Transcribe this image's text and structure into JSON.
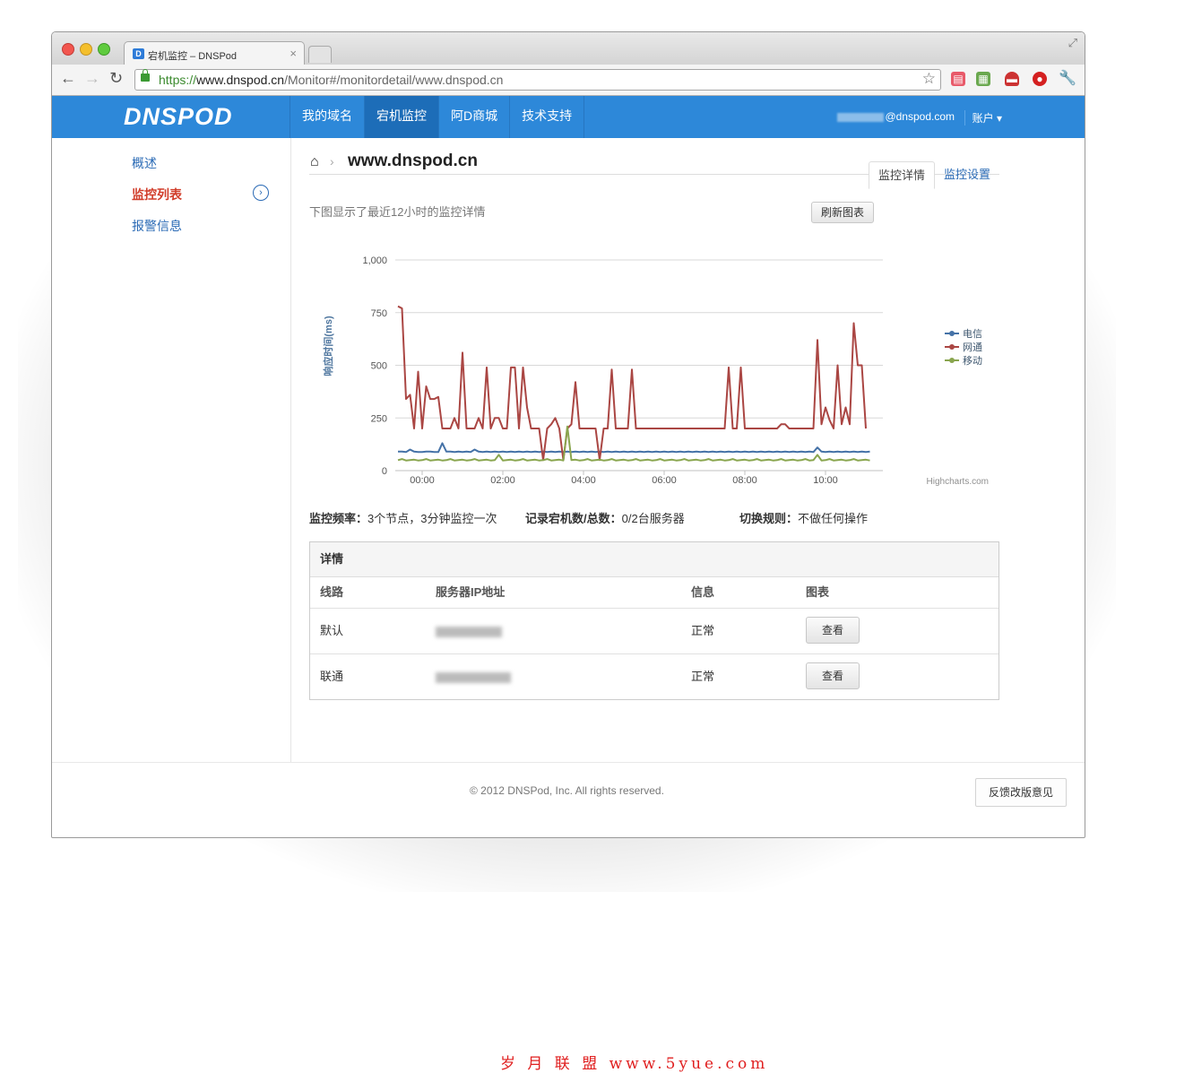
{
  "browser": {
    "tab_title": "宕机监控 – DNSPod",
    "tab_close": "×",
    "url_scheme": "https://",
    "url_host": "www.dnspod.cn",
    "url_path": "/Monitor#/monitordetail/www.dnspod.cn"
  },
  "site": {
    "logo": "DNSPOD",
    "nav": [
      "我的域名",
      "宕机监控",
      "阿D商城",
      "技术支持"
    ],
    "user_email": "@dnspod.com",
    "account_label": "账户 ▾"
  },
  "sidebar": {
    "items": [
      {
        "label": "概述"
      },
      {
        "label": "监控列表"
      },
      {
        "label": "报警信息"
      }
    ]
  },
  "breadcrumb": {
    "domain": "www.dnspod.cn"
  },
  "tabs": {
    "detail": "监控详情",
    "settings": "监控设置"
  },
  "chart_area": {
    "description": "下图显示了最近12小时的监控详情",
    "refresh_button": "刷新图表",
    "credit": "Highcharts.com"
  },
  "chart_data": {
    "type": "line",
    "title": "",
    "ylabel": "响应时间(ms)",
    "xlabel": "",
    "ylim": [
      0,
      1000
    ],
    "yticks": [
      "0",
      "250",
      "500",
      "750",
      "1,000"
    ],
    "xticks": [
      "00:00",
      "02:00",
      "04:00",
      "06:00",
      "08:00",
      "10:00"
    ],
    "x_hours": [
      -0.6,
      -0.5,
      -0.4,
      -0.3,
      -0.2,
      -0.1,
      0.0,
      0.1,
      0.2,
      0.3,
      0.4,
      0.5,
      0.6,
      0.7,
      0.8,
      0.9,
      1.0,
      1.1,
      1.2,
      1.3,
      1.4,
      1.5,
      1.6,
      1.7,
      1.8,
      1.9,
      2.0,
      2.1,
      2.2,
      2.3,
      2.4,
      2.5,
      2.6,
      2.7,
      2.8,
      2.9,
      3.0,
      3.1,
      3.2,
      3.3,
      3.4,
      3.5,
      3.6,
      3.7,
      3.8,
      3.9,
      4.0,
      4.1,
      4.2,
      4.3,
      4.4,
      4.5,
      4.6,
      4.7,
      4.8,
      4.9,
      5.0,
      5.1,
      5.2,
      5.3,
      5.4,
      5.5,
      5.6,
      5.7,
      5.8,
      5.9,
      6.0,
      6.1,
      6.2,
      6.3,
      6.4,
      6.5,
      6.6,
      6.7,
      6.8,
      6.9,
      7.0,
      7.1,
      7.2,
      7.3,
      7.4,
      7.5,
      7.6,
      7.7,
      7.8,
      7.9,
      8.0,
      8.1,
      8.2,
      8.3,
      8.4,
      8.5,
      8.6,
      8.7,
      8.8,
      8.9,
      9.0,
      9.1,
      9.2,
      9.3,
      9.4,
      9.5,
      9.6,
      9.7,
      9.8,
      9.9,
      10.0,
      10.1,
      10.2,
      10.3,
      10.4,
      10.5,
      10.6,
      10.7,
      10.8,
      10.9,
      11.0,
      11.1,
      11.2
    ],
    "series": [
      {
        "name": "电信",
        "color": "#4572a7",
        "values": [
          90,
          90,
          88,
          100,
          90,
          88,
          88,
          90,
          90,
          88,
          88,
          130,
          90,
          90,
          88,
          90,
          88,
          90,
          88,
          100,
          90,
          88,
          90,
          88,
          90,
          88,
          90,
          88,
          90,
          88,
          90,
          88,
          90,
          88,
          90,
          88,
          90,
          88,
          90,
          88,
          90,
          88,
          90,
          88,
          90,
          88,
          90,
          88,
          90,
          88,
          90,
          88,
          90,
          88,
          90,
          88,
          90,
          88,
          90,
          88,
          90,
          88,
          90,
          88,
          90,
          88,
          90,
          88,
          90,
          88,
          90,
          88,
          90,
          88,
          90,
          88,
          90,
          88,
          90,
          88,
          90,
          88,
          90,
          88,
          90,
          88,
          90,
          88,
          90,
          88,
          90,
          88,
          90,
          88,
          90,
          88,
          90,
          88,
          90,
          88,
          90,
          88,
          90,
          88,
          110,
          90,
          88,
          90,
          88,
          90,
          88,
          90,
          88,
          90,
          88,
          90,
          88,
          90
        ]
      },
      {
        "name": "网通",
        "color": "#aa4643",
        "values": [
          780,
          770,
          340,
          360,
          200,
          470,
          200,
          400,
          340,
          340,
          350,
          200,
          200,
          200,
          250,
          200,
          560,
          200,
          200,
          200,
          250,
          200,
          490,
          200,
          250,
          250,
          200,
          200,
          490,
          490,
          200,
          490,
          300,
          200,
          200,
          200,
          50,
          200,
          220,
          250,
          200,
          50,
          200,
          220,
          420,
          200,
          200,
          200,
          200,
          200,
          50,
          200,
          200,
          480,
          200,
          200,
          200,
          200,
          480,
          200,
          200,
          200,
          200,
          200,
          200,
          200,
          200,
          200,
          200,
          200,
          200,
          200,
          200,
          200,
          200,
          200,
          200,
          200,
          200,
          200,
          200,
          200,
          490,
          200,
          200,
          490,
          200,
          200,
          200,
          200,
          200,
          200,
          200,
          200,
          200,
          220,
          220,
          200,
          200,
          200,
          200,
          200,
          200,
          200,
          620,
          220,
          300,
          240,
          200,
          500,
          220,
          300,
          220,
          700,
          500,
          500,
          200
        ]
      },
      {
        "name": "移动",
        "color": "#89a54e",
        "values": [
          50,
          55,
          48,
          50,
          52,
          48,
          50,
          55,
          48,
          50,
          52,
          48,
          50,
          55,
          48,
          50,
          52,
          48,
          50,
          55,
          48,
          50,
          52,
          48,
          50,
          75,
          48,
          50,
          52,
          48,
          50,
          55,
          48,
          50,
          52,
          48,
          50,
          55,
          48,
          50,
          52,
          48,
          210,
          50,
          52,
          48,
          50,
          55,
          48,
          50,
          52,
          48,
          50,
          55,
          48,
          50,
          52,
          48,
          50,
          55,
          48,
          50,
          52,
          48,
          50,
          55,
          48,
          50,
          52,
          48,
          50,
          55,
          48,
          50,
          52,
          48,
          50,
          55,
          48,
          50,
          52,
          48,
          50,
          55,
          48,
          50,
          52,
          48,
          50,
          55,
          48,
          50,
          52,
          48,
          50,
          55,
          48,
          50,
          52,
          48,
          50,
          55,
          48,
          50,
          75,
          48,
          50,
          55,
          48,
          50,
          52,
          48,
          50,
          55,
          48,
          50,
          52,
          48
        ]
      }
    ],
    "legend": "right",
    "grid": true
  },
  "stats": {
    "freq_label": "监控频率：",
    "freq_value": "3个节点，3分钟监控一次",
    "count_label": "记录宕机数/总数：",
    "count_value": "0/2台服务器",
    "rule_label": "切换规则：",
    "rule_value": "不做任何操作"
  },
  "details": {
    "caption": "详情",
    "headers": [
      "线路",
      "服务器IP地址",
      "信息",
      "图表"
    ],
    "rows": [
      {
        "line": "默认",
        "status": "正常",
        "action": "查看"
      },
      {
        "line": "联通",
        "status": "正常",
        "action": "查看"
      }
    ]
  },
  "footer": {
    "copyright": "© 2012 DNSPod, Inc. All rights reserved.",
    "feedback": "反馈改版意见"
  },
  "watermark": "岁 月 联 盟  www.5yue.com"
}
